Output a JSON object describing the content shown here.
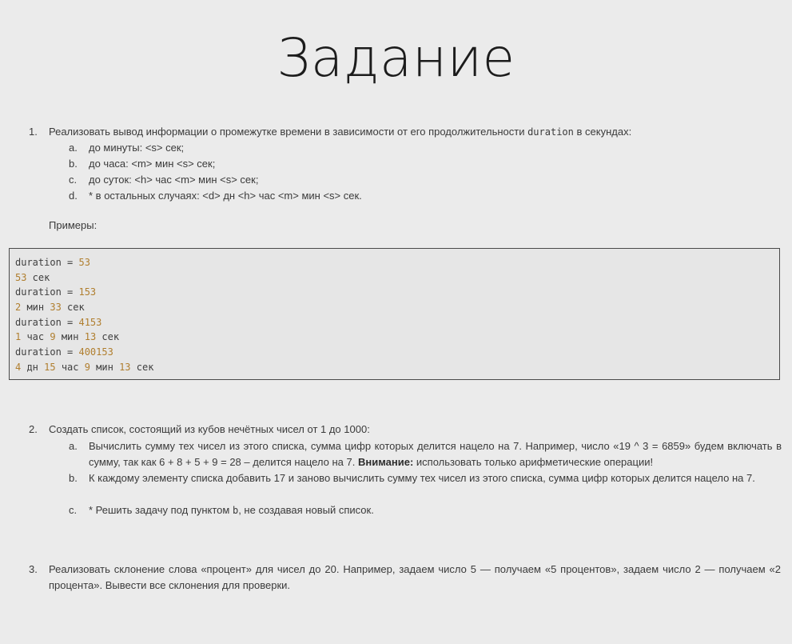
{
  "title": "Задание",
  "task1": {
    "number": "1.",
    "text_before": "Реализовать вывод информации о промежутке времени в зависимости от его продолжительности ",
    "code_word": "duration",
    "text_after": " в секундах:",
    "subitems": [
      {
        "letter": "a.",
        "text": "до минуты: <s> сек;"
      },
      {
        "letter": "b.",
        "text": "до часа: <m> мин <s> сек;"
      },
      {
        "letter": "c.",
        "text": "до суток: <h> час <m> мин <s> сек;"
      },
      {
        "letter": "d.",
        "text": "* в остальных случаях: <d> дн <h> час <m> мин <s> сек."
      }
    ],
    "examples_label": "Примеры:"
  },
  "code": {
    "lines": [
      {
        "parts": [
          {
            "t": "duration = "
          },
          {
            "t": "53",
            "n": true
          }
        ]
      },
      {
        "parts": [
          {
            "t": "53",
            "n": true
          },
          {
            "t": " сек"
          }
        ]
      },
      {
        "parts": [
          {
            "t": "duration = "
          },
          {
            "t": "153",
            "n": true
          }
        ]
      },
      {
        "parts": [
          {
            "t": "2",
            "n": true
          },
          {
            "t": " мин "
          },
          {
            "t": "33",
            "n": true
          },
          {
            "t": " сек"
          }
        ]
      },
      {
        "parts": [
          {
            "t": "duration = "
          },
          {
            "t": "4153",
            "n": true
          }
        ]
      },
      {
        "parts": [
          {
            "t": "1",
            "n": true
          },
          {
            "t": " час "
          },
          {
            "t": "9",
            "n": true
          },
          {
            "t": " мин "
          },
          {
            "t": "13",
            "n": true
          },
          {
            "t": " сек"
          }
        ]
      },
      {
        "parts": [
          {
            "t": "duration = "
          },
          {
            "t": "400153",
            "n": true
          }
        ]
      },
      {
        "parts": [
          {
            "t": "4",
            "n": true
          },
          {
            "t": " дн "
          },
          {
            "t": "15",
            "n": true
          },
          {
            "t": " час "
          },
          {
            "t": "9",
            "n": true
          },
          {
            "t": " мин "
          },
          {
            "t": "13",
            "n": true
          },
          {
            "t": " сек"
          }
        ]
      }
    ]
  },
  "task2": {
    "number": "2.",
    "text": "Создать список, состоящий из кубов нечётных чисел от 1 до 1000:",
    "a": {
      "letter": "a.",
      "text_before": "Вычислить сумму тех чисел из этого списка, сумма цифр которых делится нацело на 7. Например, число «19 ^ 3 = 6859» будем включать в сумму, так как 6 + 8 + 5 + 9 = 28 – делится нацело на 7. ",
      "bold": "Внимание:",
      "text_after": " использовать только арифметические операции!"
    },
    "b": {
      "letter": "b.",
      "text": "К каждому элементу списка добавить 17 и заново вычислить сумму тех чисел из этого списка, сумма цифр которых делится нацело на 7."
    },
    "c": {
      "letter": "c.",
      "text_before": "* Решить задачу под пунктом ",
      "code_word": "b",
      "text_after": ", не создавая новый список."
    }
  },
  "task3": {
    "number": "3.",
    "text": "Реализовать склонение слова «процент» для чисел до 20. Например, задаем число 5 — получаем «5 процентов», задаем число 2 — получаем «2 процента». Вывести все склонения для проверки."
  }
}
